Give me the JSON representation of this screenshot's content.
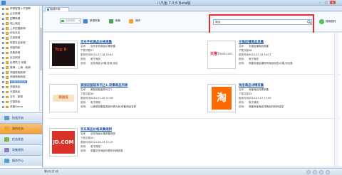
{
  "window": {
    "title": "八爪鱼 7.2.5 Beta版"
  },
  "tab": {
    "label": "规则市场"
  },
  "toolbar": {
    "combo_label": "全部规则",
    "new_label": "新增采集",
    "refresh_label": "刷新",
    "action_label": "操作"
  },
  "search": {
    "value": "商品",
    "close_label": "搜索规则"
  },
  "sidebar": {
    "tree": [
      "申报智慧人才招聘",
      "企业新闻",
      "招聘新闻",
      "网上商店",
      "上车挖掘新闻",
      "优化社区",
      "买家新闻",
      "阿里社区新闻",
      "淘宝同款",
      "采集新闻",
      "社交网站",
      "世界热门-采集",
      "微博 - 上海 - 新闻",
      "淘宝搜索新闻",
      "淘宝搜索新闻",
      "淘宝搜索新闻",
      "淘宝商品",
      "天猫商品",
      "京东 - 新闻",
      "天猫商品",
      "采集Demo"
    ],
    "selected_index": 15,
    "nav": [
      {
        "label": "快速开始"
      },
      {
        "label": "我的任务"
      },
      {
        "label": "任务状态"
      },
      {
        "label": "采集规则"
      },
      {
        "label": "服务中心"
      }
    ],
    "active_nav": 1
  },
  "cards": [
    {
      "title": "京东手机商品价格采集",
      "thumb_text": "Top 8",
      "rows": [
        {
          "k": "名称:",
          "v": "京东手机商品价格采集"
        },
        {
          "k": "下载次数:",
          "v": "27"
        },
        {
          "k": "更新时间:",
          "v": "2014-07-16 10:42"
        },
        {
          "k": "类别:",
          "v": "电子商务"
        },
        {
          "k": "说明:",
          "v": "京东商品,价格,名称,评论"
        }
      ]
    },
    {
      "title": "天猫店铺商品采集",
      "thumb_text": "天猫",
      "thumb_sub": "Tmall.com",
      "rows": [
        {
          "k": "名称:",
          "v": "天猫店铺商品采集"
        },
        {
          "k": "下载次数:",
          "v": "38"
        },
        {
          "k": "更新时间:",
          "v": "2014-07-16 14:27"
        },
        {
          "k": "类别:",
          "v": "电子商务"
        },
        {
          "k": "说明:",
          "v": "采集天猫店铺所有商品信息,价格,评论数"
        }
      ]
    },
    {
      "title": "美丽说服装系列之1:采集商品列表",
      "thumb_text": "美丽说",
      "rows": [
        {
          "k": "名称:",
          "v": "美丽说服装系列之1"
        },
        {
          "k": "下载次数:",
          "v": "30"
        },
        {
          "k": "更新时间:",
          "v": "2014-07-20 11:06"
        },
        {
          "k": "类别:",
          "v": "电子商务"
        },
        {
          "k": "说明:",
          "v": "以美丽说服装商品列表为例,获取商品名称"
        }
      ]
    },
    {
      "title": "淘宝商品详情采集",
      "thumb_text": "淘",
      "rows": [
        {
          "k": "名称:",
          "v": "淘宝商品详情采集"
        },
        {
          "k": "下载次数:",
          "v": "25"
        },
        {
          "k": "更新时间:",
          "v": "2014-07-27 17:09"
        },
        {
          "k": "类别:",
          "v": "电子商务"
        },
        {
          "k": "说明:",
          "v": "采集淘宝商品详情页的所有信息"
        }
      ]
    },
    {
      "title": "京东商品价格采集规则",
      "thumb_text": "JD.COM",
      "rows": [
        {
          "k": "名称:",
          "v": "京东商品价格采集规则"
        },
        {
          "k": "下载次数:",
          "v": "20"
        },
        {
          "k": "更新时间:",
          "v": "2014-06-19 15:19"
        },
        {
          "k": "类别:",
          "v": "电子商务"
        },
        {
          "k": "说明:",
          "v": "采集京东商品列表的价格信息"
        }
      ]
    }
  ],
  "status": {
    "text": "第1页,共1页"
  },
  "colors": {
    "accent": "#3a7bd5",
    "highlight": "#e62e2e",
    "active_nav": "#ef9a35"
  }
}
